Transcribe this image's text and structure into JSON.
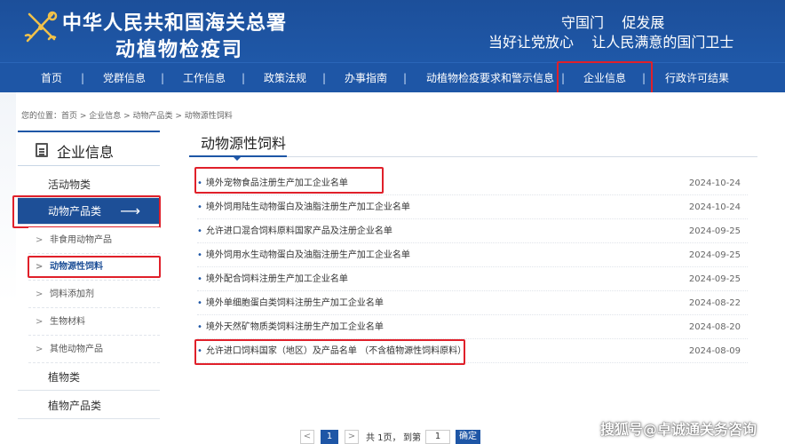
{
  "header": {
    "org_name": "中华人民共和国海关总署",
    "org_dept": "动植物检疫司",
    "slogan_line1": "守国门    促发展",
    "slogan_line2": "当好让党放心    让人民满意的国门卫士"
  },
  "nav": {
    "items": [
      {
        "label": "首页"
      },
      {
        "label": "党群信息"
      },
      {
        "label": "工作信息"
      },
      {
        "label": "政策法规"
      },
      {
        "label": "办事指南"
      },
      {
        "label": "动植物检疫要求和警示信息"
      },
      {
        "label": "企业信息"
      },
      {
        "label": "行政许可结果"
      }
    ],
    "separator": "|",
    "active_index": 6
  },
  "breadcrumb": "您的位置：首页 > 企业信息 > 动物产品类 > 动物源性饲料",
  "sidebar": {
    "title": "企业信息",
    "categories": [
      {
        "label": "活动物类"
      },
      {
        "label": "动物产品类",
        "arrow": "⟶"
      },
      {
        "label": "植物类"
      },
      {
        "label": "植物产品类"
      }
    ],
    "subitems": [
      {
        "label": "非食用动物产品"
      },
      {
        "label": "动物源性饲料"
      },
      {
        "label": "饲料添加剂"
      },
      {
        "label": "生物材料"
      },
      {
        "label": "其他动物产品"
      }
    ],
    "sub_marker": ">"
  },
  "main": {
    "title": "动物源性饲料",
    "bullet": "•",
    "rows": [
      {
        "title": "境外宠物食品注册生产加工企业名单",
        "date": "2024-10-24"
      },
      {
        "title": "境外饲用陆生动物蛋白及油脂注册生产加工企业名单",
        "date": "2024-10-24"
      },
      {
        "title": "允许进口混合饲料原料国家产品及注册企业名单",
        "date": "2024-09-25"
      },
      {
        "title": "境外饲用水生动物蛋白及油脂注册生产加工企业名单",
        "date": "2024-09-25"
      },
      {
        "title": "境外配合饲料注册生产加工企业名单",
        "date": "2024-09-25"
      },
      {
        "title": "境外单细胞蛋白类饲料注册生产加工企业名单",
        "date": "2024-08-22"
      },
      {
        "title": "境外天然矿物质类饲料注册生产加工企业名单",
        "date": "2024-08-20"
      },
      {
        "title": "允许进口饲料国家（地区）及产品名单 （不含植物源性饲料原料）",
        "date": "2024-08-09"
      }
    ]
  },
  "pager": {
    "prev": "<",
    "current": "1",
    "next": ">",
    "total_text": "共 1页，",
    "goto_text": "到第",
    "goto_value": "1",
    "go_label": "确定"
  },
  "watermark": "搜狐号@卓诚通关务咨询",
  "colors": {
    "header_blue": "#1f58a8",
    "nav_blue": "#1e56a6",
    "active_side": "#1d4f97",
    "highlight_red": "#e0202a"
  }
}
